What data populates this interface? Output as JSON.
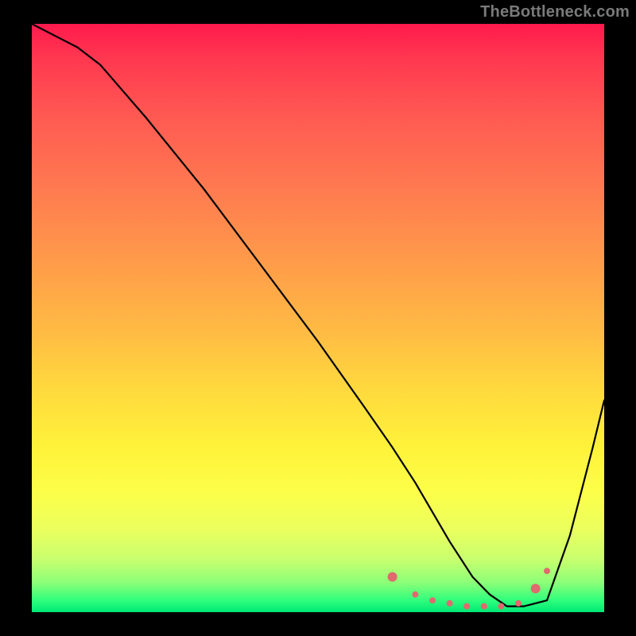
{
  "watermark": "TheBottleneck.com",
  "chart_data": {
    "type": "line",
    "title": "",
    "xlabel": "",
    "ylabel": "",
    "xlim": [
      0,
      100
    ],
    "ylim": [
      0,
      100
    ],
    "grid": false,
    "series": [
      {
        "name": "curve",
        "x": [
          0,
          4,
          8,
          12,
          20,
          30,
          40,
          50,
          58,
          63,
          67,
          70,
          73,
          77,
          80,
          83,
          86,
          90,
          94,
          98,
          100
        ],
        "y": [
          100,
          98,
          96,
          93,
          84,
          72,
          59,
          46,
          35,
          28,
          22,
          17,
          12,
          6,
          3,
          1,
          1,
          2,
          13,
          28,
          36
        ]
      }
    ],
    "highlight_points": {
      "color": "#e06a6e",
      "radius_small": 4,
      "radius_big": 6,
      "points": [
        {
          "x": 63,
          "y": 6,
          "r": "big"
        },
        {
          "x": 67,
          "y": 3,
          "r": "small"
        },
        {
          "x": 70,
          "y": 2,
          "r": "small"
        },
        {
          "x": 73,
          "y": 1.5,
          "r": "small"
        },
        {
          "x": 76,
          "y": 1,
          "r": "small"
        },
        {
          "x": 79,
          "y": 1,
          "r": "small"
        },
        {
          "x": 82,
          "y": 1,
          "r": "small"
        },
        {
          "x": 85,
          "y": 1.5,
          "r": "small"
        },
        {
          "x": 88,
          "y": 4,
          "r": "big"
        },
        {
          "x": 90,
          "y": 7,
          "r": "small"
        }
      ]
    },
    "gradient_meaning": "background heatmap: red=high bottleneck at top, green=optimal at bottom"
  }
}
